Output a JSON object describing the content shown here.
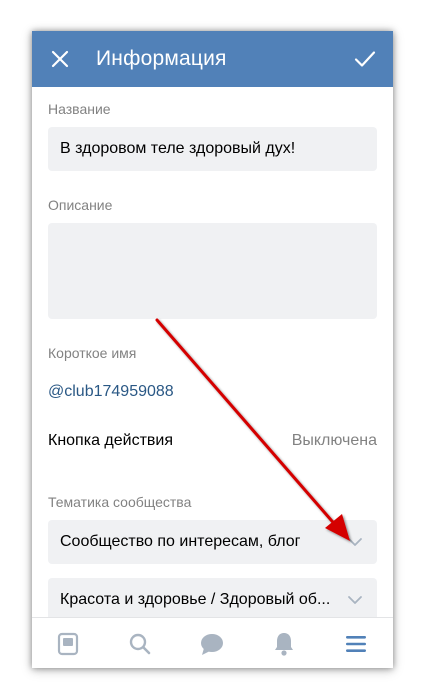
{
  "header": {
    "title": "Информация"
  },
  "form": {
    "name_label": "Название",
    "name_value": "В здоровом теле здоровый дух!",
    "description_label": "Описание",
    "description_value": "",
    "short_name_label": "Короткое имя",
    "short_name_value": "@club174959088",
    "action_button_label": "Кнопка действия",
    "action_button_value": "Выключена",
    "topic_label": "Тематика сообщества",
    "topic_value": "Сообщество по интересам, блог",
    "subtopic_value": "Красота и здоровье / Здоровый об..."
  },
  "tabbar": {
    "items": [
      "news-icon",
      "search-icon",
      "messages-icon",
      "notifications-icon",
      "menu-icon"
    ],
    "active": "menu-icon"
  },
  "colors": {
    "header_bg": "#5181b8",
    "tab_inactive": "#a9b4c1",
    "tab_active": "#5181b8",
    "link": "#2a5885",
    "annotation_arrow": "#d40000"
  }
}
